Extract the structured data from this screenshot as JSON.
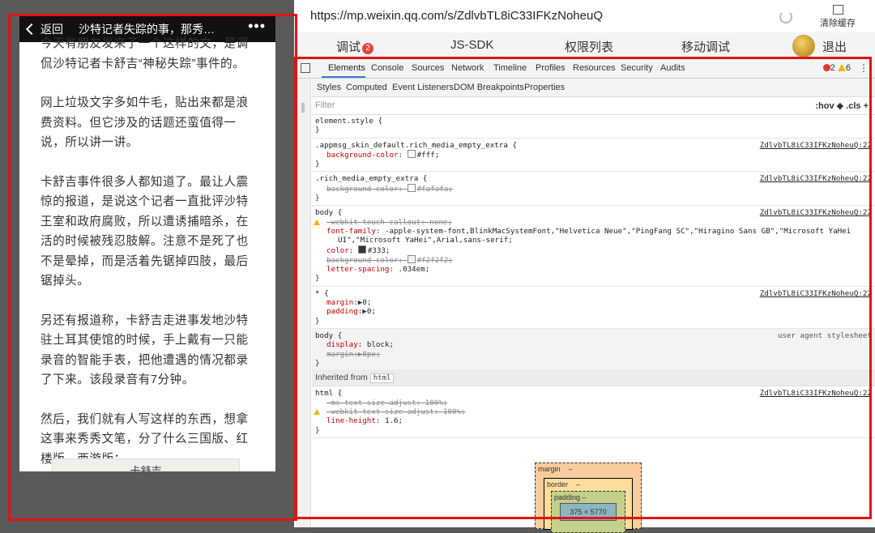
{
  "phone": {
    "back_label": "返回",
    "title": "沙特记者失踪的事，那秀…",
    "more": "•••",
    "paragraphs": [
      "今天有朋友发来了一个这样的文，是调侃沙特记者卡舒吉“神秘失踪”事件的。",
      "网上垃圾文字多如牛毛，贴出来都是浪费资料。但它涉及的话题还蛮值得一说，所以讲一讲。",
      "卡舒吉事件很多人都知道了。最让人震惊的报道，是说这个记者一直批评沙特王室和政府腐败，所以遭诱捕暗杀，在活的时候被残忍肢解。注意不是死了也不是晕掉，而是活着先锯掉四肢，最后锯掉头。",
      "另还有报道称，卡舒吉走进事发地沙特驻土耳其使馆的时候，手上戴有一只能录音的智能手表，把他遭遇的情况都录了下来。该段录音有7分钟。",
      "然后，我们就有人写这样的东西，想拿这事来秀秀文笔，分了什么三国版、红楼版、西游版："
    ],
    "card_text": "卡舒吉"
  },
  "browser": {
    "url": "https://mp.weixin.qq.com/s/ZdlvbTL8iC33IFKzNoheuQ",
    "clear_cache": "清除缓存"
  },
  "top_tabs": {
    "debug": "调试",
    "debug_badge": "2",
    "jssdk": "JS-SDK",
    "permissions": "权限列表",
    "mobile_debug": "移动调试",
    "logout": "退出"
  },
  "devtools": {
    "tabs": [
      "Elements",
      "Console",
      "Sources",
      "Network",
      "Timeline",
      "Profiles",
      "Resources",
      "Security",
      "Audits"
    ],
    "errors": "2",
    "warnings": "6",
    "subtabs": [
      "Styles",
      "Computed",
      "Event Listeners",
      "DOM Breakpoints",
      "Properties"
    ],
    "filter_placeholder": "Filter",
    "filter_tools": ":hov  ◆  .cls  +",
    "source_link": "ZdlvbTL8iC33IFKzNoheuQ:22",
    "ua_label": "user agent stylesheet",
    "rules": [
      {
        "selector": "element.style {",
        "props": []
      },
      {
        "selector": ".appmsg_skin_default.rich_media_empty_extra {",
        "props": [
          {
            "name": "background-color",
            "value": "#fff;"
          }
        ]
      },
      {
        "selector": ".rich_media_empty_extra {",
        "props": [
          {
            "name": "background-color",
            "value": "#fafafa;"
          }
        ]
      },
      {
        "selector": "body {",
        "props": [
          {
            "name": "-webkit-touch-callout",
            "value": "none;"
          },
          {
            "name": "font-family",
            "value": "-apple-system-font,BlinkMacSystemFont,\"Helvetica Neue\",\"PingFang SC\",\"Hiragino Sans GB\",\"Microsoft YaHei"
          },
          {
            "name": "",
            "value": "UI\",\"Microsoft YaHei\",Arial,sans-serif;"
          },
          {
            "name": "color",
            "value": "#333;"
          },
          {
            "name": "background-color",
            "value": "#f2f2f2;"
          },
          {
            "name": "letter-spacing",
            "value": ".034em;"
          }
        ]
      },
      {
        "selector": "* {",
        "props": [
          {
            "name": "margin",
            "value": "0;"
          },
          {
            "name": "padding",
            "value": "0;"
          }
        ]
      },
      {
        "selector": "body {",
        "props": [
          {
            "name": "display",
            "value": "block;"
          },
          {
            "name": "margin",
            "value": "8px;"
          }
        ]
      },
      {
        "selector": "html {",
        "props": [
          {
            "name": "-ms-text-size-adjust",
            "value": "100%;"
          },
          {
            "name": "-webkit-text-size-adjust",
            "value": "100%;"
          },
          {
            "name": "line-height",
            "value": "1.6;"
          }
        ]
      }
    ],
    "inherited_label": "Inherited from",
    "inherited_tag": "html",
    "boxmodel": {
      "margin": "margin",
      "margin_val": "–",
      "border": "border",
      "border_val": "–",
      "padding": "padding –",
      "content": "375 × 5770"
    }
  }
}
